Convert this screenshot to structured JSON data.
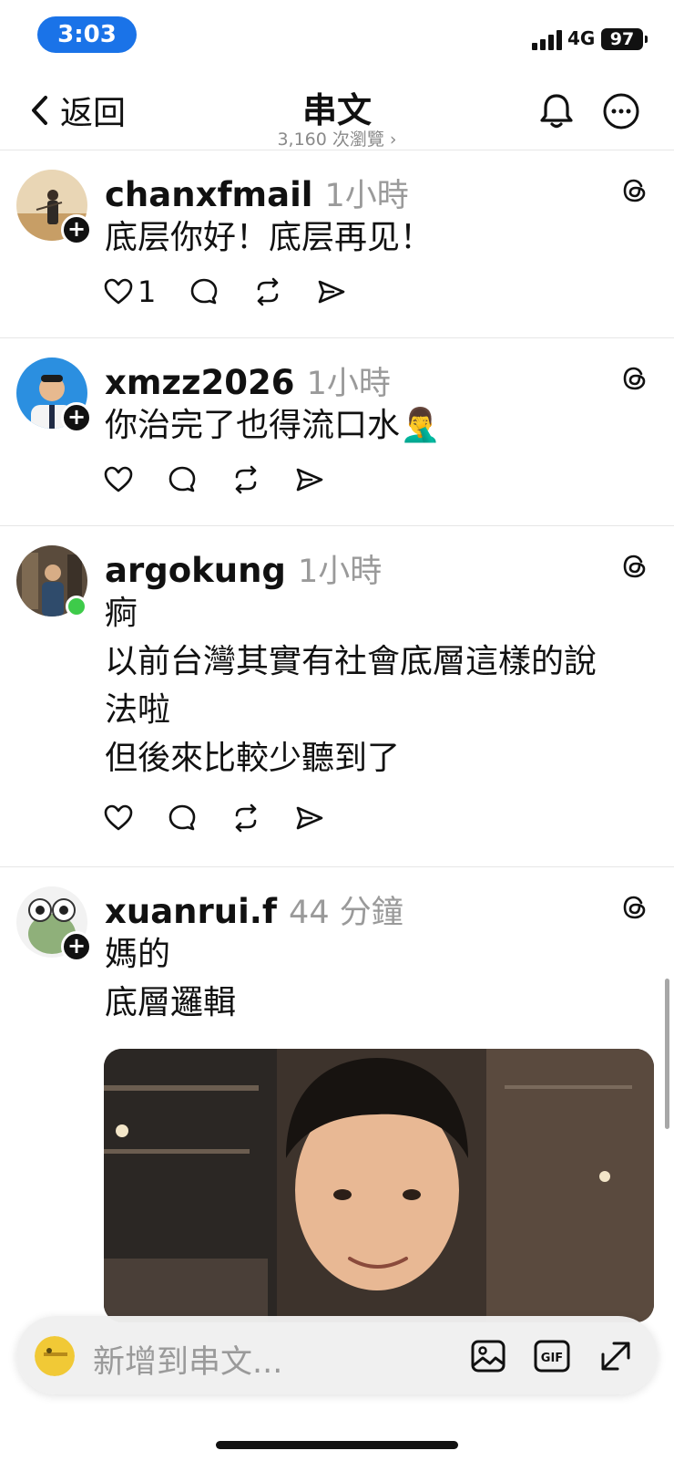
{
  "status_bar": {
    "time": "3:03",
    "network": "4G",
    "battery": "97"
  },
  "header": {
    "back_label": "返回",
    "title": "串文",
    "views": "3,160 次瀏覽 ›"
  },
  "posts": [
    {
      "username": "chanxfmail",
      "time": "1小時",
      "lines": [
        "底层你好！底层再见！"
      ],
      "likes": "1"
    },
    {
      "username": "xmzz2026",
      "time": "1小時",
      "lines": [
        "你治完了也得流口水🤦‍♂️"
      ],
      "likes": ""
    },
    {
      "username": "argokung",
      "time": "1小時",
      "lines": [
        "痾",
        "以前台灣其實有社會底層這樣的說",
        "法啦",
        "但後來比較少聽到了"
      ],
      "likes": ""
    },
    {
      "username": "xuanrui.f",
      "time": "44 分鐘",
      "lines": [
        "媽的",
        "底層邏輯"
      ],
      "likes": ""
    }
  ],
  "composer": {
    "placeholder": "新增到串文..."
  },
  "icons": [
    "back-chevron-icon",
    "bell-icon",
    "more-icon",
    "threads-icon",
    "heart-icon",
    "comment-icon",
    "repost-icon",
    "share-icon",
    "image-icon",
    "gif-icon",
    "expand-icon"
  ]
}
